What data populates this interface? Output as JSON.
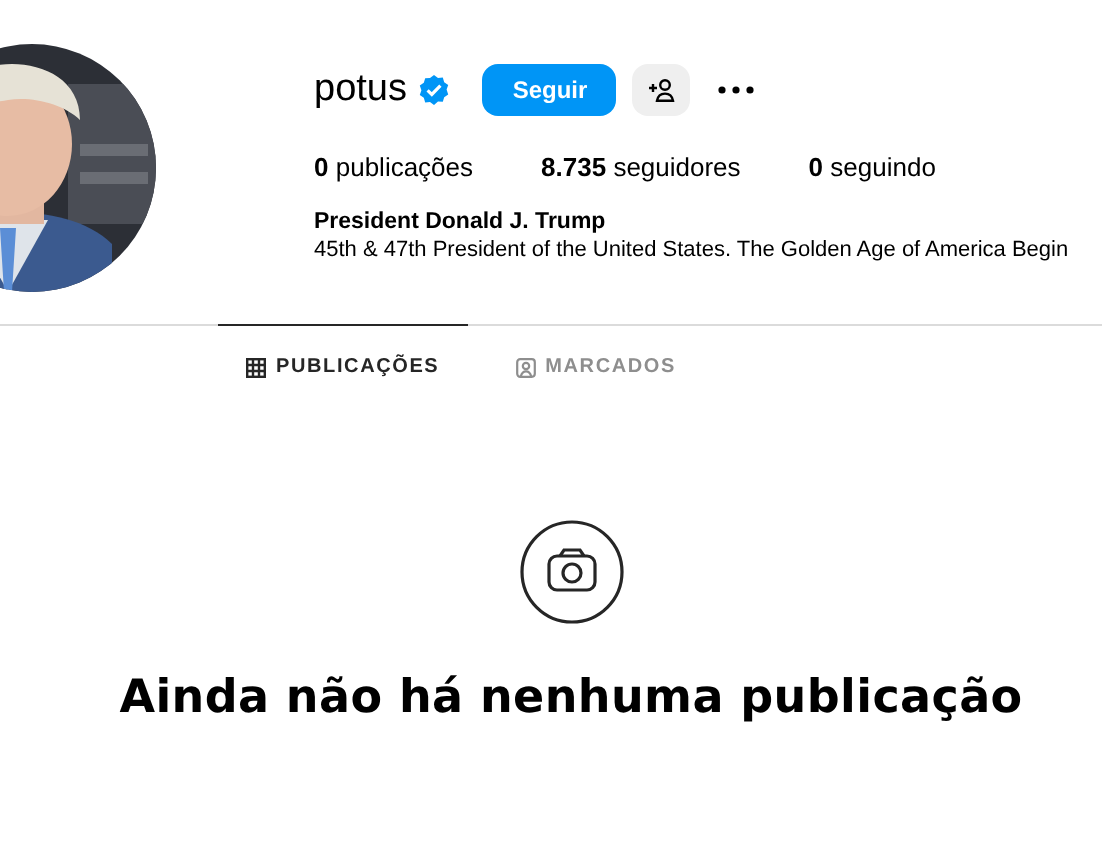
{
  "profile": {
    "username": "potus",
    "verified": true,
    "follow_button": "Seguir",
    "stats": [
      {
        "count": "0",
        "label": "publicações"
      },
      {
        "count": "8.735",
        "label": "seguidores"
      },
      {
        "count": "0",
        "label": "seguindo"
      }
    ],
    "name": "President Donald J. Trump",
    "bio": "45th & 47th President of the United States. The Golden Age of America Begin"
  },
  "tabs": [
    {
      "label": "PUBLICAÇÕES",
      "kind": "grid",
      "selected": true
    },
    {
      "label": "MARCADOS",
      "kind": "tag",
      "selected": false
    }
  ],
  "empty_state": {
    "message": "Ainda não há nenhuma publicação"
  }
}
